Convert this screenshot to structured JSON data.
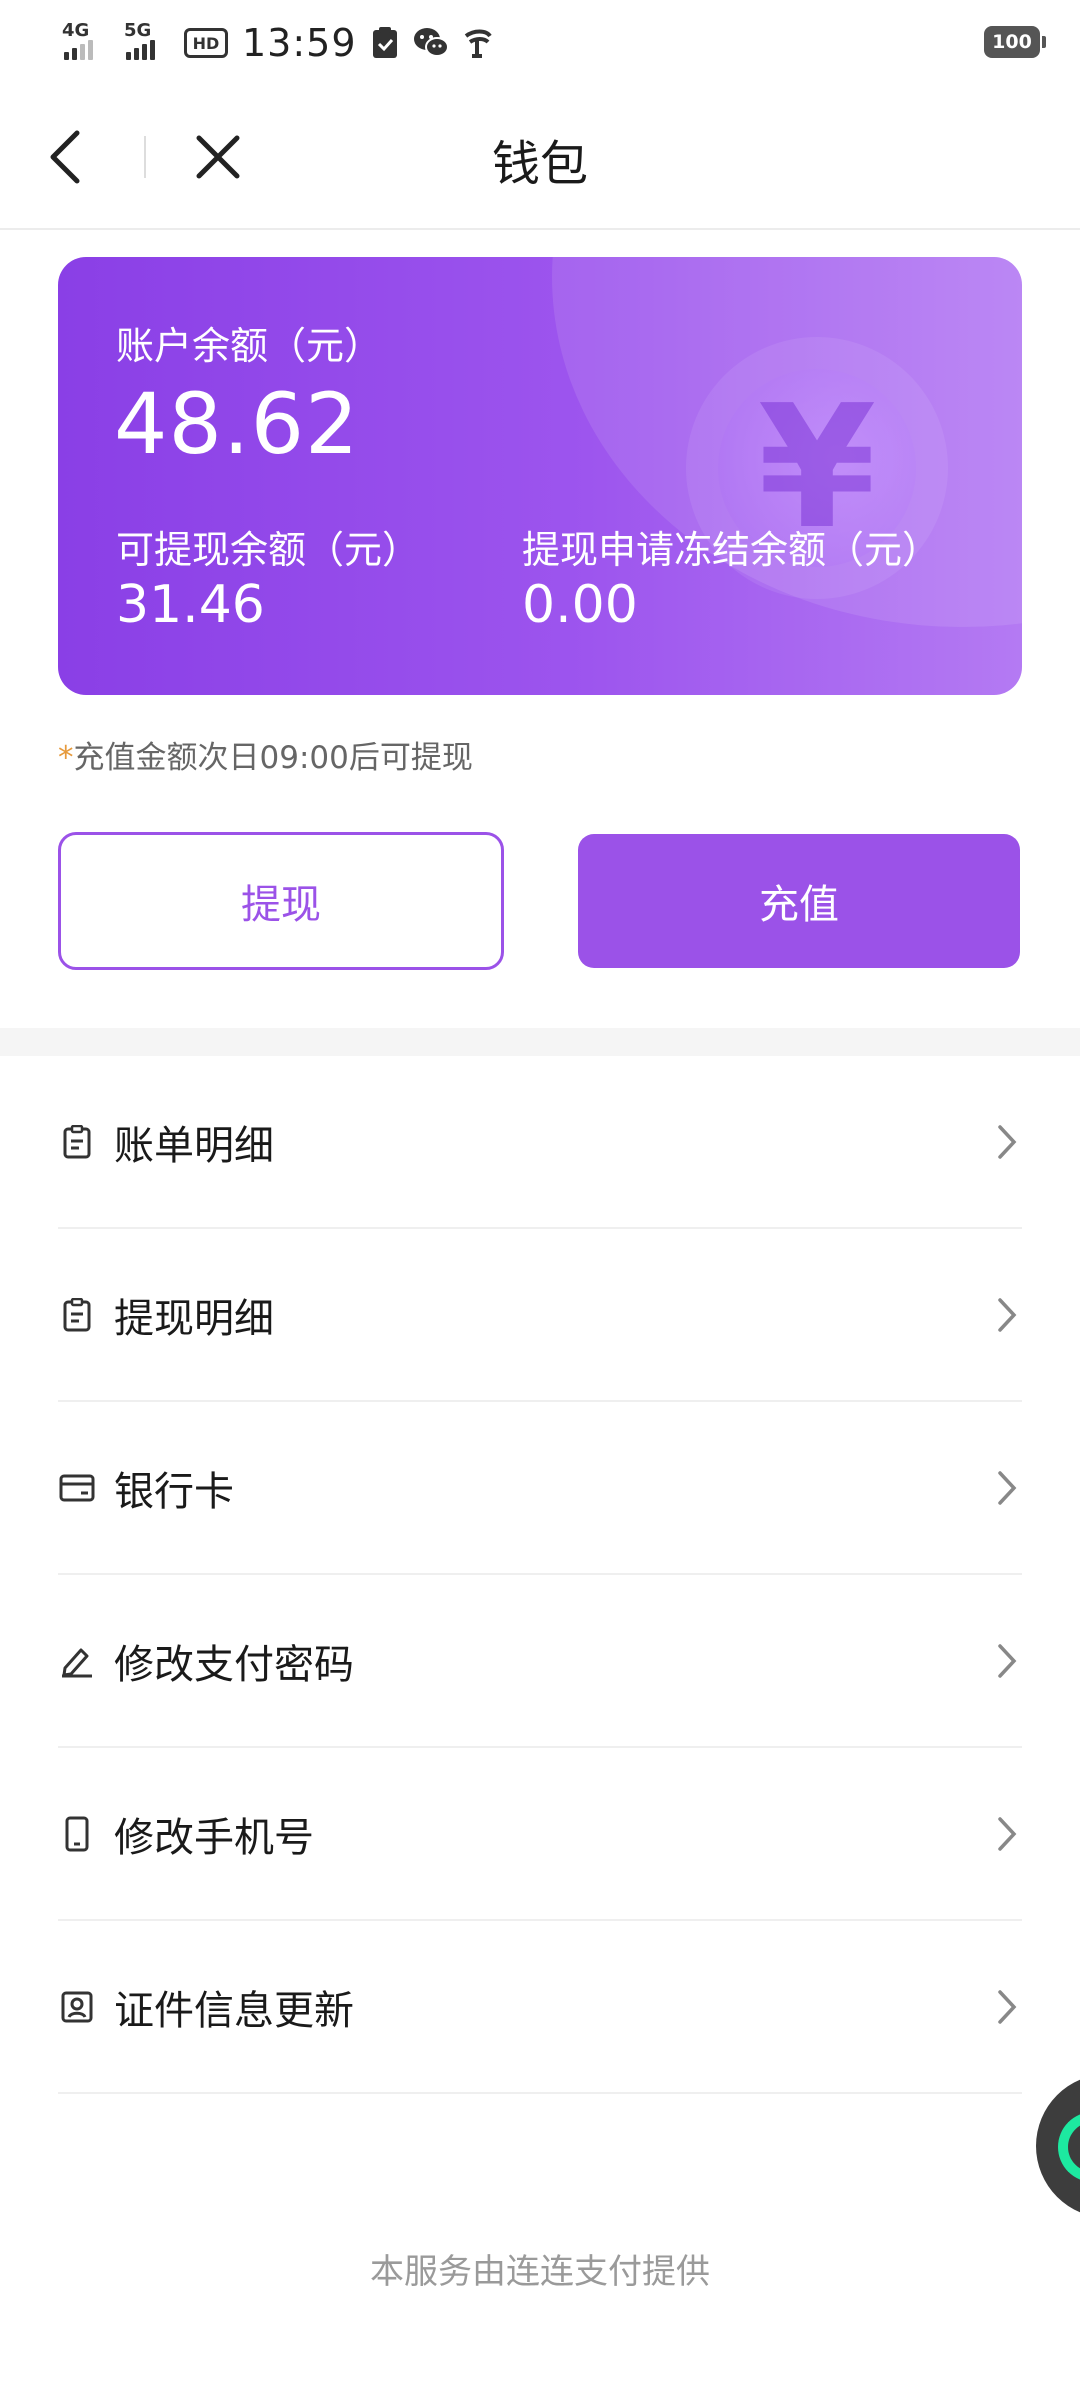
{
  "status_bar": {
    "signal_1": "4G",
    "signal_2": "5G",
    "hd": "HD",
    "time": "13:59",
    "battery": "100",
    "icons": [
      "clipboard-check-icon",
      "wechat-icon",
      "telecom-icon"
    ]
  },
  "nav": {
    "title": "钱包",
    "back_icon": "chevron-left-icon",
    "close_icon": "close-icon"
  },
  "balance": {
    "label": "账户余额（元）",
    "value": "48.62",
    "withdrawable_label": "可提现余额（元）",
    "withdrawable_value": "31.46",
    "frozen_label": "提现申请冻结余额（元）",
    "frozen_value": "0.00",
    "decor_glyph": "¥",
    "gradient": [
      "#8a3fe6",
      "#b47af3"
    ]
  },
  "notice": {
    "star": "*",
    "text": "充值金额次日09:00后可提现"
  },
  "actions": {
    "withdraw": "提现",
    "recharge": "充值",
    "accent": "#9b52e8"
  },
  "menu": [
    {
      "label": "账单明细",
      "icon": "clipboard-icon"
    },
    {
      "label": "提现明细",
      "icon": "clipboard-icon"
    },
    {
      "label": "银行卡",
      "icon": "card-icon"
    },
    {
      "label": "修改支付密码",
      "icon": "pen-icon"
    },
    {
      "label": "修改手机号",
      "icon": "phone-icon"
    },
    {
      "label": "证件信息更新",
      "icon": "id-badge-icon"
    }
  ],
  "footer": "本服务由连连支付提供"
}
